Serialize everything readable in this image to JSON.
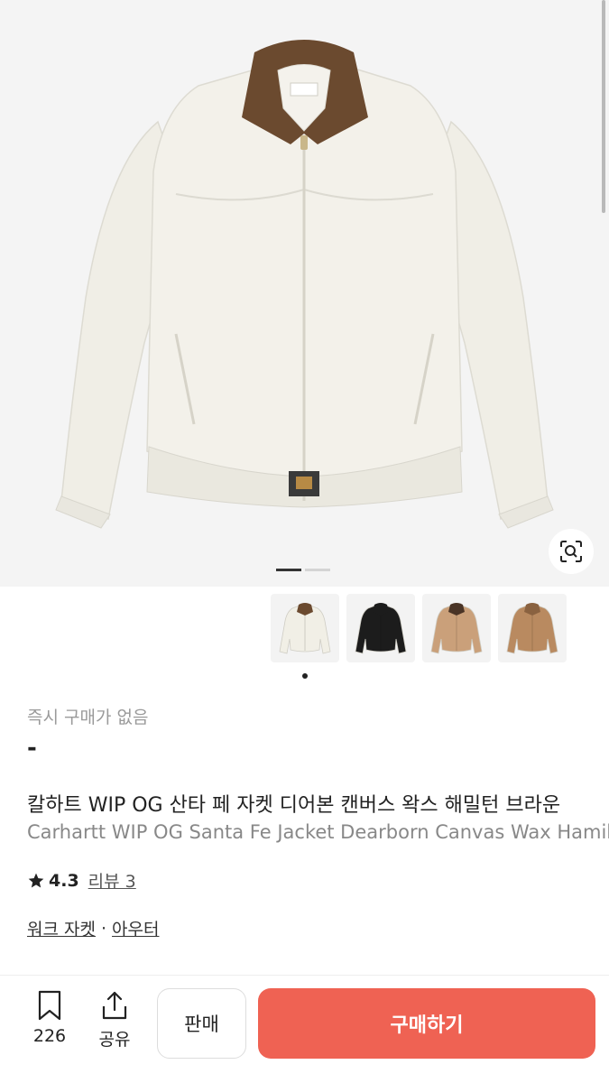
{
  "product": {
    "status_text": "즉시 구매가 없음",
    "price": "-",
    "title_ko": "칼하트 WIP OG 산타 페 자켓 디어본 캔버스 왁스 해밀턴 브라운",
    "title_en": "Carhartt WIP OG Santa Fe Jacket Dearborn Canvas Wax Hamilton Brown",
    "rating": "4.3",
    "review_label": "리뷰 3",
    "categories": [
      "워크 자켓",
      "아우터"
    ],
    "category_separator": "·"
  },
  "gallery": {
    "current_page": 1,
    "page_count": 2,
    "lens_icon": "image-search-icon",
    "thumbnails": [
      {
        "icon": "jacket-white-thumbnail",
        "body": "#f1efe6",
        "collar": "#6b4a2f"
      },
      {
        "icon": "jacket-black-thumbnail",
        "body": "#1c1c1c",
        "collar": "#1c1c1c"
      },
      {
        "icon": "jacket-tan-thumbnail",
        "body": "#caa07a",
        "collar": "#4a3426"
      },
      {
        "icon": "jacket-brown-thumbnail",
        "body": "#b98a60",
        "collar": "#8a6240"
      }
    ],
    "selected_thumbnail": 0
  },
  "bottom_bar": {
    "bookmark_count": "226",
    "bookmark_icon": "bookmark-icon",
    "share_label": "공유",
    "share_icon": "share-icon",
    "sell_label": "판매",
    "buy_label": "구매하기"
  },
  "colors": {
    "buy_button": "#ef6253",
    "hero_background": "#f4f4f4"
  }
}
